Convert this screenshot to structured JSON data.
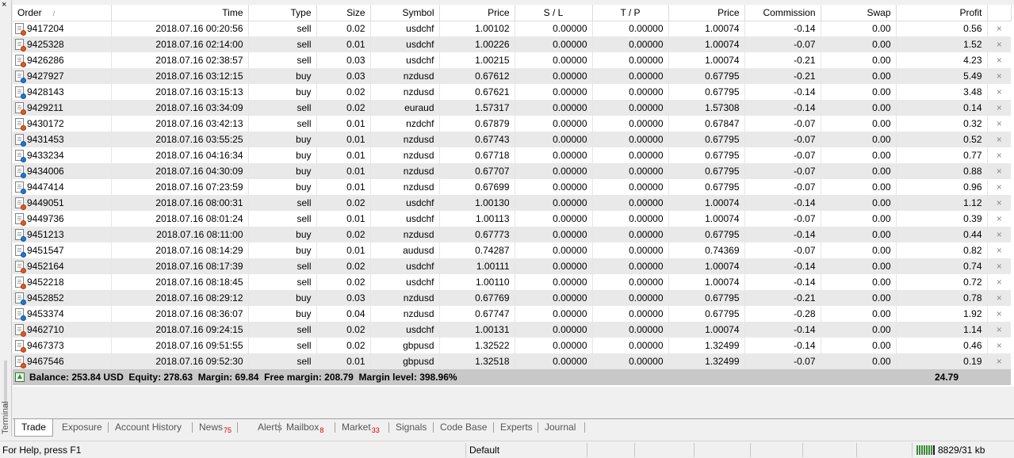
{
  "side": {
    "close_glyph": "×",
    "label": "Terminal"
  },
  "columns": {
    "order": "Order",
    "time": "Time",
    "type": "Type",
    "size": "Size",
    "symbol": "Symbol",
    "price": "Price",
    "sl": "S / L",
    "tp": "T / P",
    "price2": "Price",
    "commission": "Commission",
    "swap": "Swap",
    "profit": "Profit"
  },
  "sort_indicator": "/",
  "close_glyph": "×",
  "colors": {
    "sell_dot": "#e05a1e",
    "buy_dot": "#1e78d2",
    "summary_bg": "#c8c8c8",
    "badge": "#d00000"
  },
  "icons": {
    "sell": "order-doc-sell-icon",
    "buy": "order-doc-buy-icon",
    "summary": "balance-up-arrow-icon"
  },
  "rows": [
    {
      "order": "9417204",
      "time": "2018.07.16 00:20:56",
      "type": "sell",
      "size": "0.02",
      "symbol": "usdchf",
      "price": "1.00102",
      "sl": "0.00000",
      "tp": "0.00000",
      "price2": "1.00074",
      "commission": "-0.14",
      "swap": "0.00",
      "profit": "0.56"
    },
    {
      "order": "9425328",
      "time": "2018.07.16 02:14:00",
      "type": "sell",
      "size": "0.01",
      "symbol": "usdchf",
      "price": "1.00226",
      "sl": "0.00000",
      "tp": "0.00000",
      "price2": "1.00074",
      "commission": "-0.07",
      "swap": "0.00",
      "profit": "1.52"
    },
    {
      "order": "9426286",
      "time": "2018.07.16 02:38:57",
      "type": "sell",
      "size": "0.03",
      "symbol": "usdchf",
      "price": "1.00215",
      "sl": "0.00000",
      "tp": "0.00000",
      "price2": "1.00074",
      "commission": "-0.21",
      "swap": "0.00",
      "profit": "4.23"
    },
    {
      "order": "9427927",
      "time": "2018.07.16 03:12:15",
      "type": "buy",
      "size": "0.03",
      "symbol": "nzdusd",
      "price": "0.67612",
      "sl": "0.00000",
      "tp": "0.00000",
      "price2": "0.67795",
      "commission": "-0.21",
      "swap": "0.00",
      "profit": "5.49"
    },
    {
      "order": "9428143",
      "time": "2018.07.16 03:15:13",
      "type": "buy",
      "size": "0.02",
      "symbol": "nzdusd",
      "price": "0.67621",
      "sl": "0.00000",
      "tp": "0.00000",
      "price2": "0.67795",
      "commission": "-0.14",
      "swap": "0.00",
      "profit": "3.48"
    },
    {
      "order": "9429211",
      "time": "2018.07.16 03:34:09",
      "type": "sell",
      "size": "0.02",
      "symbol": "euraud",
      "price": "1.57317",
      "sl": "0.00000",
      "tp": "0.00000",
      "price2": "1.57308",
      "commission": "-0.14",
      "swap": "0.00",
      "profit": "0.14"
    },
    {
      "order": "9430172",
      "time": "2018.07.16 03:42:13",
      "type": "sell",
      "size": "0.01",
      "symbol": "nzdchf",
      "price": "0.67879",
      "sl": "0.00000",
      "tp": "0.00000",
      "price2": "0.67847",
      "commission": "-0.07",
      "swap": "0.00",
      "profit": "0.32"
    },
    {
      "order": "9431453",
      "time": "2018.07.16 03:55:25",
      "type": "buy",
      "size": "0.01",
      "symbol": "nzdusd",
      "price": "0.67743",
      "sl": "0.00000",
      "tp": "0.00000",
      "price2": "0.67795",
      "commission": "-0.07",
      "swap": "0.00",
      "profit": "0.52"
    },
    {
      "order": "9433234",
      "time": "2018.07.16 04:16:34",
      "type": "buy",
      "size": "0.01",
      "symbol": "nzdusd",
      "price": "0.67718",
      "sl": "0.00000",
      "tp": "0.00000",
      "price2": "0.67795",
      "commission": "-0.07",
      "swap": "0.00",
      "profit": "0.77"
    },
    {
      "order": "9434006",
      "time": "2018.07.16 04:30:09",
      "type": "buy",
      "size": "0.01",
      "symbol": "nzdusd",
      "price": "0.67707",
      "sl": "0.00000",
      "tp": "0.00000",
      "price2": "0.67795",
      "commission": "-0.07",
      "swap": "0.00",
      "profit": "0.88"
    },
    {
      "order": "9447414",
      "time": "2018.07.16 07:23:59",
      "type": "buy",
      "size": "0.01",
      "symbol": "nzdusd",
      "price": "0.67699",
      "sl": "0.00000",
      "tp": "0.00000",
      "price2": "0.67795",
      "commission": "-0.07",
      "swap": "0.00",
      "profit": "0.96"
    },
    {
      "order": "9449051",
      "time": "2018.07.16 08:00:31",
      "type": "sell",
      "size": "0.02",
      "symbol": "usdchf",
      "price": "1.00130",
      "sl": "0.00000",
      "tp": "0.00000",
      "price2": "1.00074",
      "commission": "-0.14",
      "swap": "0.00",
      "profit": "1.12"
    },
    {
      "order": "9449736",
      "time": "2018.07.16 08:01:24",
      "type": "sell",
      "size": "0.01",
      "symbol": "usdchf",
      "price": "1.00113",
      "sl": "0.00000",
      "tp": "0.00000",
      "price2": "1.00074",
      "commission": "-0.07",
      "swap": "0.00",
      "profit": "0.39"
    },
    {
      "order": "9451213",
      "time": "2018.07.16 08:11:00",
      "type": "buy",
      "size": "0.02",
      "symbol": "nzdusd",
      "price": "0.67773",
      "sl": "0.00000",
      "tp": "0.00000",
      "price2": "0.67795",
      "commission": "-0.14",
      "swap": "0.00",
      "profit": "0.44"
    },
    {
      "order": "9451547",
      "time": "2018.07.16 08:14:29",
      "type": "buy",
      "size": "0.01",
      "symbol": "audusd",
      "price": "0.74287",
      "sl": "0.00000",
      "tp": "0.00000",
      "price2": "0.74369",
      "commission": "-0.07",
      "swap": "0.00",
      "profit": "0.82"
    },
    {
      "order": "9452164",
      "time": "2018.07.16 08:17:39",
      "type": "sell",
      "size": "0.02",
      "symbol": "usdchf",
      "price": "1.00111",
      "sl": "0.00000",
      "tp": "0.00000",
      "price2": "1.00074",
      "commission": "-0.14",
      "swap": "0.00",
      "profit": "0.74"
    },
    {
      "order": "9452218",
      "time": "2018.07.16 08:18:45",
      "type": "sell",
      "size": "0.02",
      "symbol": "usdchf",
      "price": "1.00110",
      "sl": "0.00000",
      "tp": "0.00000",
      "price2": "1.00074",
      "commission": "-0.14",
      "swap": "0.00",
      "profit": "0.72"
    },
    {
      "order": "9452852",
      "time": "2018.07.16 08:29:12",
      "type": "buy",
      "size": "0.03",
      "symbol": "nzdusd",
      "price": "0.67769",
      "sl": "0.00000",
      "tp": "0.00000",
      "price2": "0.67795",
      "commission": "-0.21",
      "swap": "0.00",
      "profit": "0.78"
    },
    {
      "order": "9453374",
      "time": "2018.07.16 08:36:07",
      "type": "buy",
      "size": "0.04",
      "symbol": "nzdusd",
      "price": "0.67747",
      "sl": "0.00000",
      "tp": "0.00000",
      "price2": "0.67795",
      "commission": "-0.28",
      "swap": "0.00",
      "profit": "1.92"
    },
    {
      "order": "9462710",
      "time": "2018.07.16 09:24:15",
      "type": "sell",
      "size": "0.02",
      "symbol": "usdchf",
      "price": "1.00131",
      "sl": "0.00000",
      "tp": "0.00000",
      "price2": "1.00074",
      "commission": "-0.14",
      "swap": "0.00",
      "profit": "1.14"
    },
    {
      "order": "9467373",
      "time": "2018.07.16 09:51:55",
      "type": "sell",
      "size": "0.02",
      "symbol": "gbpusd",
      "price": "1.32522",
      "sl": "0.00000",
      "tp": "0.00000",
      "price2": "1.32499",
      "commission": "-0.14",
      "swap": "0.00",
      "profit": "0.46"
    },
    {
      "order": "9467546",
      "time": "2018.07.16 09:52:30",
      "type": "sell",
      "size": "0.01",
      "symbol": "gbpusd",
      "price": "1.32518",
      "sl": "0.00000",
      "tp": "0.00000",
      "price2": "1.32499",
      "commission": "-0.07",
      "swap": "0.00",
      "profit": "0.19"
    }
  ],
  "summary": {
    "text": "Balance: 253.84 USD  Equity: 278.63  Margin: 69.84  Free margin: 208.79  Margin level: 398.96%",
    "total_profit": "24.79"
  },
  "tabs": [
    {
      "label": "Trade",
      "badge": "",
      "active": true
    },
    {
      "label": "Exposure",
      "badge": ""
    },
    {
      "label": "Account History",
      "badge": ""
    },
    {
      "label": "News",
      "badge": "75"
    },
    {
      "label": "Alerts",
      "badge": ""
    },
    {
      "label": "Mailbox",
      "badge": "8"
    },
    {
      "label": "Market",
      "badge": "33"
    },
    {
      "label": "Signals",
      "badge": ""
    },
    {
      "label": "Code Base",
      "badge": ""
    },
    {
      "label": "Experts",
      "badge": ""
    },
    {
      "label": "Journal",
      "badge": ""
    }
  ],
  "status": {
    "help": "For Help, press F1",
    "profile": "Default",
    "traffic": "8829/31 kb"
  }
}
